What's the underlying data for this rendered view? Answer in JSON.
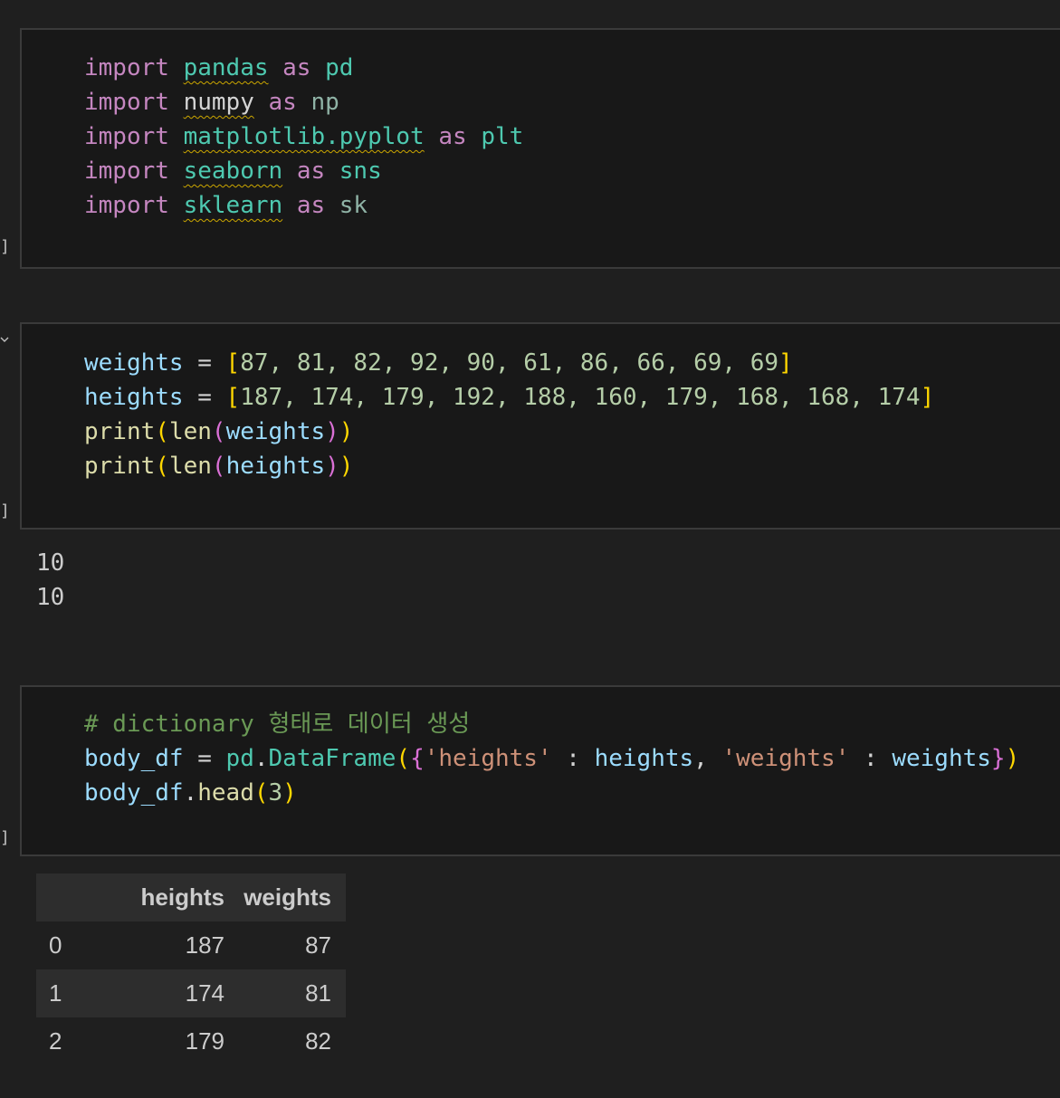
{
  "cells": [
    {
      "lines": [
        [
          {
            "t": "import",
            "c": "kw"
          },
          {
            "t": " "
          },
          {
            "t": "pandas",
            "c": "mod squig"
          },
          {
            "t": " "
          },
          {
            "t": "as",
            "c": "kw"
          },
          {
            "t": " "
          },
          {
            "t": "pd",
            "c": "mod"
          }
        ],
        [
          {
            "t": "import",
            "c": "kw"
          },
          {
            "t": " "
          },
          {
            "t": "numpy",
            "c": "plain squig"
          },
          {
            "t": " "
          },
          {
            "t": "as",
            "c": "kw"
          },
          {
            "t": " "
          },
          {
            "t": "np",
            "c": "dim"
          }
        ],
        [
          {
            "t": "import",
            "c": "kw"
          },
          {
            "t": " "
          },
          {
            "t": "matplotlib.pyplot",
            "c": "mod squig"
          },
          {
            "t": " "
          },
          {
            "t": "as",
            "c": "kw"
          },
          {
            "t": " "
          },
          {
            "t": "plt",
            "c": "mod"
          }
        ],
        [
          {
            "t": "import",
            "c": "kw"
          },
          {
            "t": " "
          },
          {
            "t": "seaborn",
            "c": "mod squig"
          },
          {
            "t": " "
          },
          {
            "t": "as",
            "c": "kw"
          },
          {
            "t": " "
          },
          {
            "t": "sns",
            "c": "mod"
          }
        ],
        [
          {
            "t": "import",
            "c": "kw"
          },
          {
            "t": " "
          },
          {
            "t": "sklearn",
            "c": "mod squig"
          },
          {
            "t": " "
          },
          {
            "t": "as",
            "c": "kw"
          },
          {
            "t": " "
          },
          {
            "t": "sk",
            "c": "dim"
          }
        ]
      ]
    },
    {
      "lines": [
        [
          {
            "t": "weights",
            "c": "var"
          },
          {
            "t": " = ",
            "c": "plain"
          },
          {
            "t": "[",
            "c": "br1"
          },
          {
            "t": "87, 81, 82, 92, 90, 61, 86, 66, 69, 69",
            "c": "num"
          },
          {
            "t": "]",
            "c": "br1"
          }
        ],
        [
          {
            "t": "heights",
            "c": "var"
          },
          {
            "t": " = ",
            "c": "plain"
          },
          {
            "t": "[",
            "c": "br1"
          },
          {
            "t": "187, 174, 179, 192, 188, 160, 179, 168, 168, 174",
            "c": "num"
          },
          {
            "t": "]",
            "c": "br1"
          }
        ],
        [
          {
            "t": "print",
            "c": "fn"
          },
          {
            "t": "(",
            "c": "br1"
          },
          {
            "t": "len",
            "c": "fn"
          },
          {
            "t": "(",
            "c": "br2"
          },
          {
            "t": "weights",
            "c": "var"
          },
          {
            "t": ")",
            "c": "br2"
          },
          {
            "t": ")",
            "c": "br1"
          }
        ],
        [
          {
            "t": "print",
            "c": "fn"
          },
          {
            "t": "(",
            "c": "br1"
          },
          {
            "t": "len",
            "c": "fn"
          },
          {
            "t": "(",
            "c": "br2"
          },
          {
            "t": "heights",
            "c": "var"
          },
          {
            "t": ")",
            "c": "br2"
          },
          {
            "t": ")",
            "c": "br1"
          }
        ]
      ]
    },
    {
      "lines": [
        [
          {
            "t": "# dictionary 형태로 데이터 생성",
            "c": "cmt"
          }
        ],
        [
          {
            "t": "body_df",
            "c": "var"
          },
          {
            "t": " = ",
            "c": "plain"
          },
          {
            "t": "pd",
            "c": "mod"
          },
          {
            "t": ".",
            "c": "plain"
          },
          {
            "t": "DataFrame",
            "c": "mod"
          },
          {
            "t": "(",
            "c": "br1"
          },
          {
            "t": "{",
            "c": "br2"
          },
          {
            "t": "'heights'",
            "c": "str"
          },
          {
            "t": " : ",
            "c": "plain"
          },
          {
            "t": "heights",
            "c": "var"
          },
          {
            "t": ", ",
            "c": "plain"
          },
          {
            "t": "'weights'",
            "c": "str"
          },
          {
            "t": " : ",
            "c": "plain"
          },
          {
            "t": "weights",
            "c": "var"
          },
          {
            "t": "}",
            "c": "br2"
          },
          {
            "t": ")",
            "c": "br1"
          }
        ],
        [
          {
            "t": "body_df",
            "c": "var"
          },
          {
            "t": ".",
            "c": "plain"
          },
          {
            "t": "head",
            "c": "fn"
          },
          {
            "t": "(",
            "c": "br1"
          },
          {
            "t": "3",
            "c": "num"
          },
          {
            "t": ")",
            "c": "br1"
          }
        ]
      ]
    }
  ],
  "gutter_marks": [
    "]",
    "]",
    "]"
  ],
  "output_lines": [
    "10",
    "10"
  ],
  "dataframe": {
    "columns": [
      "",
      "heights",
      "weights"
    ],
    "rows": [
      [
        "0",
        "187",
        "87"
      ],
      [
        "1",
        "174",
        "81"
      ],
      [
        "2",
        "179",
        "82"
      ]
    ]
  }
}
